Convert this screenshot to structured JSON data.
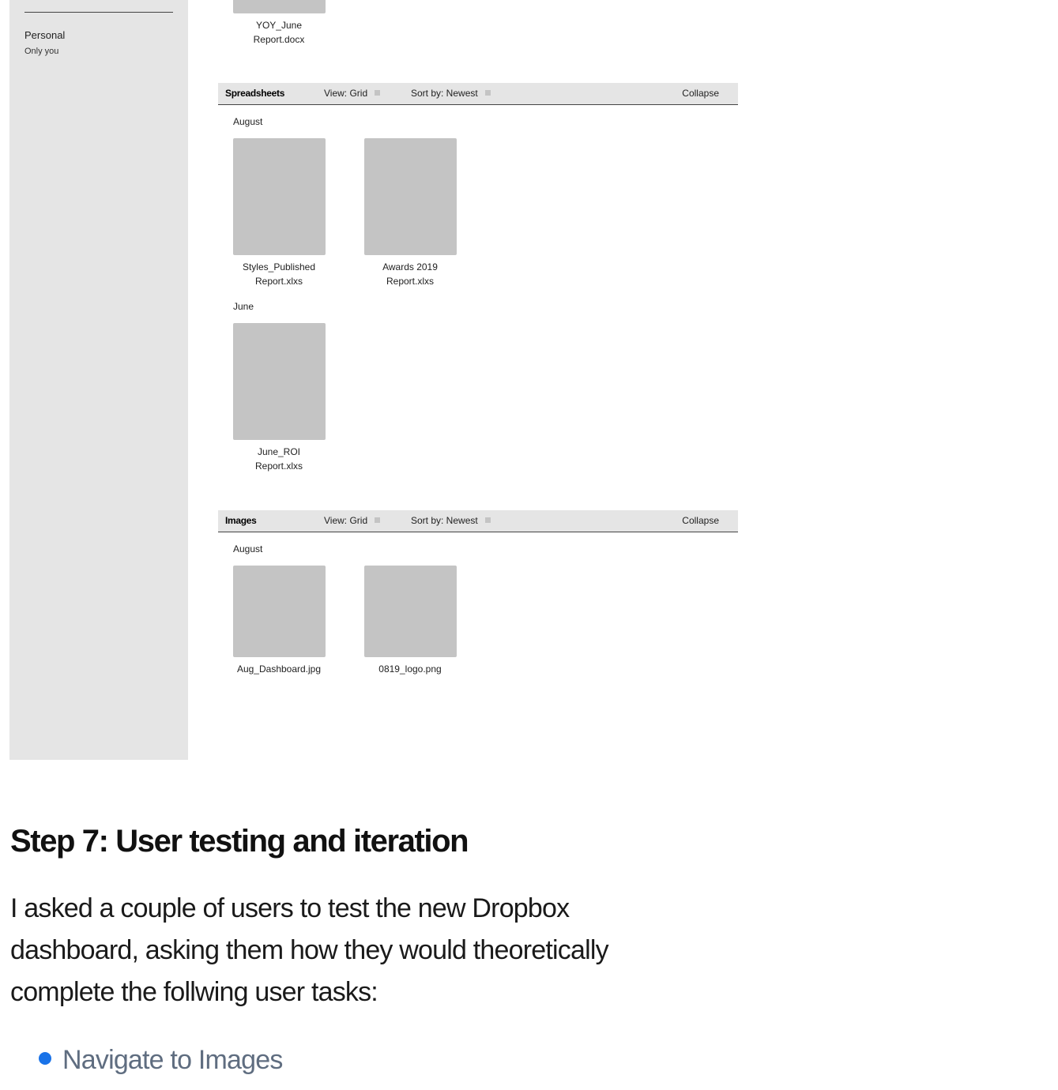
{
  "sidebar": {
    "account_name": "Personal",
    "account_sub": "Only you"
  },
  "top_partial": {
    "file": {
      "line1": "YOY_June",
      "line2": "Report.docx"
    }
  },
  "sections": {
    "spreadsheets": {
      "title": "Spreadsheets",
      "view": "View: Grid",
      "sort": "Sort by: Newest",
      "collapse": "Collapse",
      "groups": [
        {
          "month": "August",
          "files": [
            {
              "line1": "Styles_Published",
              "line2": "Report.xlxs"
            },
            {
              "line1": "Awards 2019",
              "line2": "Report.xlxs"
            }
          ]
        },
        {
          "month": "June",
          "files": [
            {
              "line1": "June_ROI",
              "line2": "Report.xlxs"
            }
          ]
        }
      ]
    },
    "images": {
      "title": "Images",
      "view": "View: Grid",
      "sort": "Sort by: Newest",
      "collapse": "Collapse",
      "groups": [
        {
          "month": "August",
          "files": [
            {
              "line1": "Aug_Dashboard.jpg"
            },
            {
              "line1": "0819_logo.png"
            }
          ]
        }
      ]
    }
  },
  "article": {
    "heading": "Step 7: User testing and iteration",
    "paragraph": "I asked a couple of users to test the new Dropbox dashboard, asking them how they would theoretically complete the follwing user tasks:",
    "list": [
      "Navigate to Images"
    ]
  }
}
